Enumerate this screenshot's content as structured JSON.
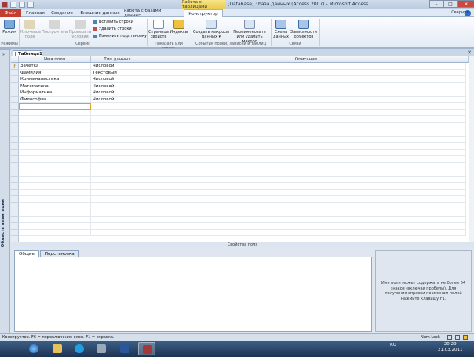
{
  "window": {
    "context_tab": "Работа с таблицами",
    "title": "[Database] : база данных (Access 2007) - Microsoft Access",
    "min": "–",
    "max": "□",
    "close": "✕"
  },
  "ribbon_tabs": [
    "Файл",
    "Главная",
    "Создание",
    "Внешние данные",
    "Работа с базами данных",
    "Конструктор"
  ],
  "ribbon": {
    "collapse": "Свернуть",
    "groups": [
      "Режимы",
      "Сервис",
      "Показать или скрыть",
      "События полей, записей и таблиц",
      "Связи"
    ],
    "mode": "Режим",
    "key": "Ключевое поле",
    "builder": "Построитель",
    "check": "Проверить условия",
    "insert_rows": "Вставить строки",
    "delete_rows": "Удалить строки",
    "change_lookup": "Изменить подстановку",
    "prop_sheet": "Страница свойств",
    "indexes": "Индексы",
    "macros": "Создать макросы данных ▾",
    "rename_macro": "Переименовать или удалить макрос",
    "schema": "Схема данных",
    "deps": "Зависимости объектов"
  },
  "nav_pane": {
    "label": "Область навигации",
    "arrow": "»"
  },
  "doc_tab": {
    "label": "Таблица1",
    "close": "✕"
  },
  "grid": {
    "headers": [
      "Имя поля",
      "Тип данных",
      "Описание"
    ],
    "rows": [
      {
        "name": "Зачётка",
        "type": "Числовой",
        "key": true
      },
      {
        "name": "Фамилия",
        "type": "Текстовый",
        "key": false
      },
      {
        "name": "Криминалистика",
        "type": "Числовой",
        "key": false
      },
      {
        "name": "Математика",
        "type": "Числовой",
        "key": false
      },
      {
        "name": "Информатика",
        "type": "Числовой",
        "key": false
      },
      {
        "name": "Философия",
        "type": "Числовой",
        "key": false
      }
    ]
  },
  "props": {
    "title": "Свойства поля",
    "tabs": [
      "Общие",
      "Подстановка"
    ],
    "hint": "Имя поля может содержать не более 64 знаков (включая пробелы). Для получения справки по именам полей нажмите клавишу F1."
  },
  "status": {
    "left": "Конструктор. F6 = переключение окон. F1 = справка.",
    "numlock": "Num Lock"
  },
  "taskbar": {
    "lang": "RU",
    "time": "20:29",
    "date": "21.03.2011"
  },
  "colors": {
    "file_tab": "#c43e2f",
    "context_tab": "#e9c84b",
    "accent": "#2e6fc6"
  }
}
